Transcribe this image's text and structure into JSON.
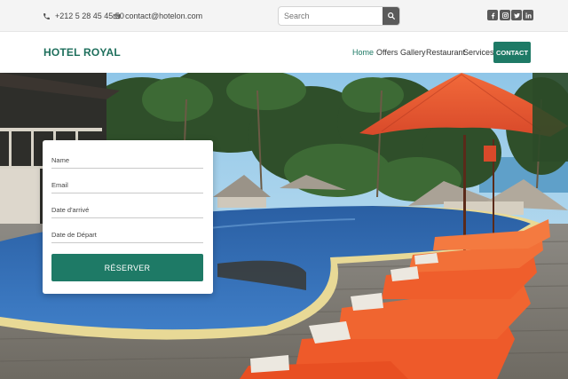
{
  "topbar": {
    "phone": "+212 5 28 45 45 50",
    "email": "contact@hotelon.com",
    "search": {
      "placeholder": "Search",
      "value": ""
    },
    "social": [
      "facebook-icon",
      "instagram-icon",
      "twitter-icon",
      "linkedin-icon"
    ]
  },
  "nav": {
    "brand": "HOTEL ROYAL",
    "links": [
      "Home",
      "Offers",
      "Gallery",
      "Restaurant",
      "Services"
    ],
    "active": "Home",
    "contact_label": "CONTACT"
  },
  "booking": {
    "name_placeholder": "Name",
    "email_placeholder": "Email",
    "arrival_placeholder": "Date d'arrivé",
    "departure_placeholder": "Date de Départ",
    "submit_label": "RÉSERVER"
  },
  "colors": {
    "accent": "#1e7a66",
    "brand": "#1e6f5c",
    "topbar_bg": "#f4f4f4"
  }
}
